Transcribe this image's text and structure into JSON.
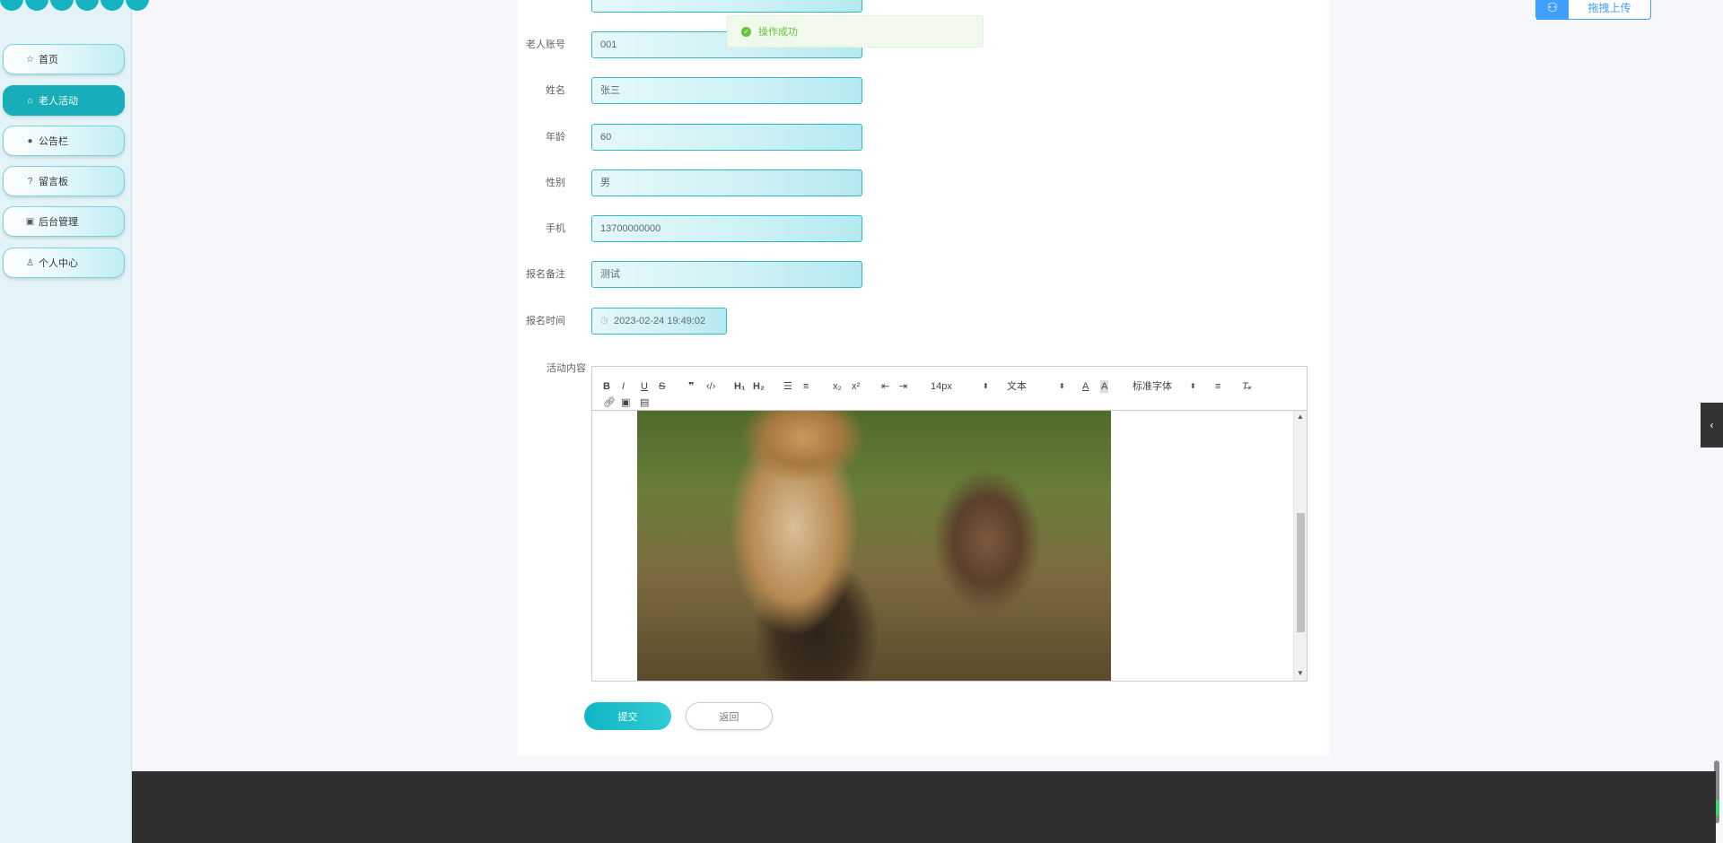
{
  "sidebar": {
    "items": [
      {
        "label": "首页",
        "icon": "star-icon",
        "active": false
      },
      {
        "label": "老人活动",
        "icon": "bag-icon",
        "active": true
      },
      {
        "label": "公告栏",
        "icon": "info-icon",
        "active": false
      },
      {
        "label": "留言板",
        "icon": "question-icon",
        "active": false
      },
      {
        "label": "后台管理",
        "icon": "box-icon",
        "active": false
      },
      {
        "label": "个人中心",
        "icon": "user-icon",
        "active": false
      }
    ]
  },
  "toast": {
    "text": "操作成功"
  },
  "form": {
    "fields": [
      {
        "label": "老人账号",
        "value": "001"
      },
      {
        "label": "姓名",
        "value": "张三"
      },
      {
        "label": "年龄",
        "value": "60"
      },
      {
        "label": "性别",
        "value": "男"
      },
      {
        "label": "手机",
        "value": "13700000000"
      },
      {
        "label": "报名备注",
        "value": "测试"
      }
    ],
    "signup_time_label": "报名时间",
    "signup_time_value": "2023-02-24 19:49:02",
    "content_label": "活动内容"
  },
  "editor": {
    "font_size": "14px",
    "text_type": "文本",
    "font_family": "标准字体"
  },
  "buttons": {
    "submit": "提交",
    "back": "返回"
  },
  "upload": {
    "label": "拖拽上传"
  },
  "colors": {
    "accent": "#18aeb9",
    "success": "#67c23a",
    "upload_blue": "#409eff",
    "footer": "#2f2f2f"
  }
}
